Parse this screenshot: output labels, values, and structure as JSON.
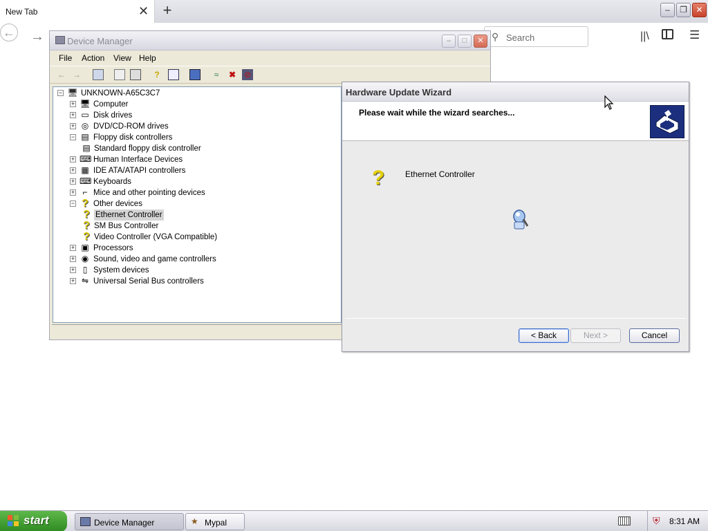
{
  "browser": {
    "tab_title": "New Tab",
    "tab_close": "✕",
    "new_tab": "+",
    "back": "←",
    "forward": "→",
    "search_placeholder": "Search",
    "controls": {
      "minimize": "–",
      "maximize": "❐",
      "close": "✕"
    }
  },
  "device_manager": {
    "title": "Device Manager",
    "menu": [
      "File",
      "Action",
      "View",
      "Help"
    ],
    "controls": {
      "minimize": "–",
      "maximize": "□",
      "close": "✕"
    },
    "toolbar": [
      "back-arrow",
      "forward-arrow",
      "show-hide-tree",
      "properties",
      "print",
      "help",
      "view",
      "update-driver",
      "scan-hardware",
      "uninstall",
      "disable"
    ],
    "tree": {
      "root": "UNKNOWN-A65C3C7",
      "items": [
        {
          "label": "Computer",
          "expander": "+",
          "icon": "computer-icon"
        },
        {
          "label": "Disk drives",
          "expander": "+",
          "icon": "disk-icon"
        },
        {
          "label": "DVD/CD-ROM drives",
          "expander": "+",
          "icon": "cdrom-icon"
        },
        {
          "label": "Floppy disk controllers",
          "expander": "−",
          "icon": "floppy-icon"
        },
        {
          "label": "Standard floppy disk controller",
          "child": true,
          "icon": "floppy-controller-icon"
        },
        {
          "label": "Human Interface Devices",
          "expander": "+",
          "icon": "hid-icon"
        },
        {
          "label": "IDE ATA/ATAPI controllers",
          "expander": "+",
          "icon": "ide-icon"
        },
        {
          "label": "Keyboards",
          "expander": "+",
          "icon": "keyboard-icon"
        },
        {
          "label": "Mice and other pointing devices",
          "expander": "+",
          "icon": "mouse-icon"
        },
        {
          "label": "Other devices",
          "expander": "−",
          "icon": "unknown-device-icon"
        },
        {
          "label": "Ethernet Controller",
          "child": true,
          "selected": true,
          "icon": "unknown-device-icon"
        },
        {
          "label": "SM Bus Controller",
          "child": true,
          "icon": "unknown-device-icon"
        },
        {
          "label": "Video Controller (VGA Compatible)",
          "child": true,
          "icon": "unknown-device-icon"
        },
        {
          "label": "Processors",
          "expander": "+",
          "icon": "processor-icon"
        },
        {
          "label": "Sound, video and game controllers",
          "expander": "+",
          "icon": "sound-icon"
        },
        {
          "label": "System devices",
          "expander": "+",
          "icon": "system-icon"
        },
        {
          "label": "Universal Serial Bus controllers",
          "expander": "+",
          "icon": "usb-icon"
        }
      ]
    }
  },
  "wizard": {
    "title": "Hardware Update Wizard",
    "heading": "Please wait while the wizard searches...",
    "device_name": "Ethernet Controller",
    "back_label": "< Back",
    "next_label": "Next >",
    "cancel_label": "Cancel"
  },
  "taskbar": {
    "start_label": "start",
    "items": [
      {
        "label": "Device Manager",
        "active": true
      },
      {
        "label": "Mypal",
        "active": false
      }
    ],
    "clock": "8:31 AM"
  }
}
